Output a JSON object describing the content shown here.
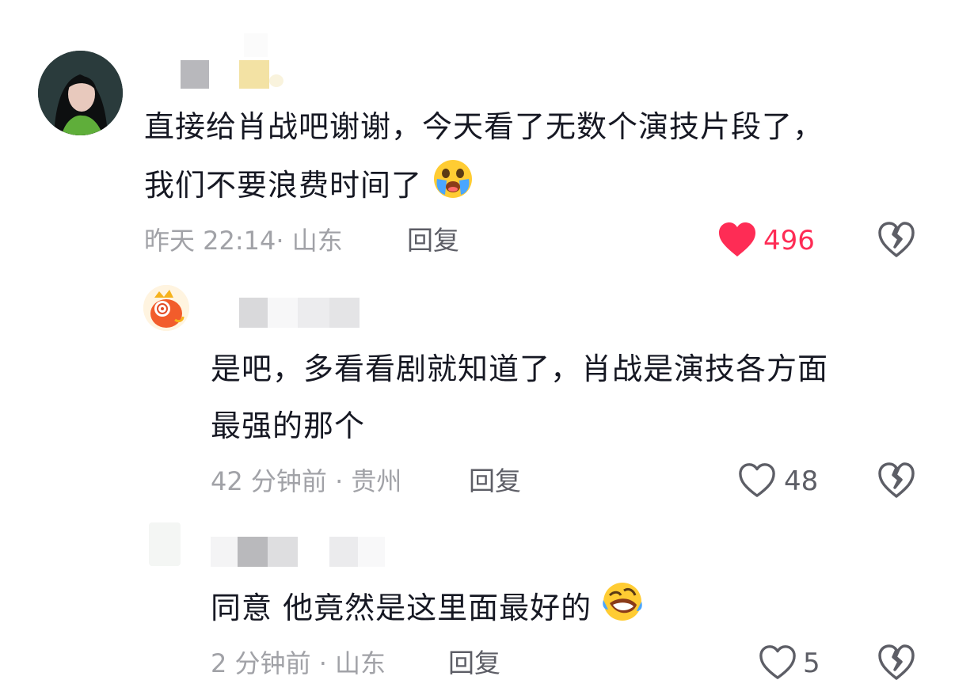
{
  "comments": [
    {
      "text_line1": "直接给肖战吧谢谢，今天看了无数个演技片段了，",
      "text_line2": "我们不要浪费时间了",
      "emoji": "loudly-crying-face",
      "meta": "昨天 22:14· 山东",
      "reply_label": "回复",
      "likes": "496",
      "liked": true
    },
    {
      "text_line1": "是吧，多看看剧就知道了，肖战是演技各方面",
      "text_line2": "最强的那个",
      "meta": "42 分钟前 · 贵州",
      "reply_label": "回复",
      "likes": "48",
      "liked": false
    },
    {
      "text_line1": "同意 他竟然是这里面最好的",
      "emoji": "rolling-on-floor-laughing",
      "meta": "2 分钟前 · 山东",
      "reply_label": "回复",
      "likes": "5",
      "liked": false
    }
  ],
  "colors": {
    "text": "#161823",
    "meta": "#a1a2a7",
    "like_active": "#fe2c55",
    "icon": "#5d5e66"
  }
}
